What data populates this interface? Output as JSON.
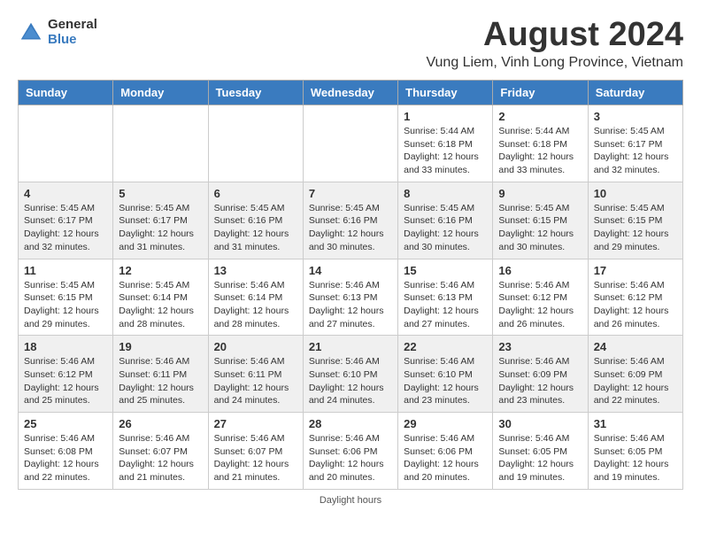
{
  "logo": {
    "general": "General",
    "blue": "Blue"
  },
  "title": {
    "month_year": "August 2024",
    "location": "Vung Liem, Vinh Long Province, Vietnam"
  },
  "headers": [
    "Sunday",
    "Monday",
    "Tuesday",
    "Wednesday",
    "Thursday",
    "Friday",
    "Saturday"
  ],
  "weeks": [
    [
      {
        "day": "",
        "info": ""
      },
      {
        "day": "",
        "info": ""
      },
      {
        "day": "",
        "info": ""
      },
      {
        "day": "",
        "info": ""
      },
      {
        "day": "1",
        "info": "Sunrise: 5:44 AM\nSunset: 6:18 PM\nDaylight: 12 hours\nand 33 minutes."
      },
      {
        "day": "2",
        "info": "Sunrise: 5:44 AM\nSunset: 6:18 PM\nDaylight: 12 hours\nand 33 minutes."
      },
      {
        "day": "3",
        "info": "Sunrise: 5:45 AM\nSunset: 6:17 PM\nDaylight: 12 hours\nand 32 minutes."
      }
    ],
    [
      {
        "day": "4",
        "info": "Sunrise: 5:45 AM\nSunset: 6:17 PM\nDaylight: 12 hours\nand 32 minutes."
      },
      {
        "day": "5",
        "info": "Sunrise: 5:45 AM\nSunset: 6:17 PM\nDaylight: 12 hours\nand 31 minutes."
      },
      {
        "day": "6",
        "info": "Sunrise: 5:45 AM\nSunset: 6:16 PM\nDaylight: 12 hours\nand 31 minutes."
      },
      {
        "day": "7",
        "info": "Sunrise: 5:45 AM\nSunset: 6:16 PM\nDaylight: 12 hours\nand 30 minutes."
      },
      {
        "day": "8",
        "info": "Sunrise: 5:45 AM\nSunset: 6:16 PM\nDaylight: 12 hours\nand 30 minutes."
      },
      {
        "day": "9",
        "info": "Sunrise: 5:45 AM\nSunset: 6:15 PM\nDaylight: 12 hours\nand 30 minutes."
      },
      {
        "day": "10",
        "info": "Sunrise: 5:45 AM\nSunset: 6:15 PM\nDaylight: 12 hours\nand 29 minutes."
      }
    ],
    [
      {
        "day": "11",
        "info": "Sunrise: 5:45 AM\nSunset: 6:15 PM\nDaylight: 12 hours\nand 29 minutes."
      },
      {
        "day": "12",
        "info": "Sunrise: 5:45 AM\nSunset: 6:14 PM\nDaylight: 12 hours\nand 28 minutes."
      },
      {
        "day": "13",
        "info": "Sunrise: 5:46 AM\nSunset: 6:14 PM\nDaylight: 12 hours\nand 28 minutes."
      },
      {
        "day": "14",
        "info": "Sunrise: 5:46 AM\nSunset: 6:13 PM\nDaylight: 12 hours\nand 27 minutes."
      },
      {
        "day": "15",
        "info": "Sunrise: 5:46 AM\nSunset: 6:13 PM\nDaylight: 12 hours\nand 27 minutes."
      },
      {
        "day": "16",
        "info": "Sunrise: 5:46 AM\nSunset: 6:12 PM\nDaylight: 12 hours\nand 26 minutes."
      },
      {
        "day": "17",
        "info": "Sunrise: 5:46 AM\nSunset: 6:12 PM\nDaylight: 12 hours\nand 26 minutes."
      }
    ],
    [
      {
        "day": "18",
        "info": "Sunrise: 5:46 AM\nSunset: 6:12 PM\nDaylight: 12 hours\nand 25 minutes."
      },
      {
        "day": "19",
        "info": "Sunrise: 5:46 AM\nSunset: 6:11 PM\nDaylight: 12 hours\nand 25 minutes."
      },
      {
        "day": "20",
        "info": "Sunrise: 5:46 AM\nSunset: 6:11 PM\nDaylight: 12 hours\nand 24 minutes."
      },
      {
        "day": "21",
        "info": "Sunrise: 5:46 AM\nSunset: 6:10 PM\nDaylight: 12 hours\nand 24 minutes."
      },
      {
        "day": "22",
        "info": "Sunrise: 5:46 AM\nSunset: 6:10 PM\nDaylight: 12 hours\nand 23 minutes."
      },
      {
        "day": "23",
        "info": "Sunrise: 5:46 AM\nSunset: 6:09 PM\nDaylight: 12 hours\nand 23 minutes."
      },
      {
        "day": "24",
        "info": "Sunrise: 5:46 AM\nSunset: 6:09 PM\nDaylight: 12 hours\nand 22 minutes."
      }
    ],
    [
      {
        "day": "25",
        "info": "Sunrise: 5:46 AM\nSunset: 6:08 PM\nDaylight: 12 hours\nand 22 minutes."
      },
      {
        "day": "26",
        "info": "Sunrise: 5:46 AM\nSunset: 6:07 PM\nDaylight: 12 hours\nand 21 minutes."
      },
      {
        "day": "27",
        "info": "Sunrise: 5:46 AM\nSunset: 6:07 PM\nDaylight: 12 hours\nand 21 minutes."
      },
      {
        "day": "28",
        "info": "Sunrise: 5:46 AM\nSunset: 6:06 PM\nDaylight: 12 hours\nand 20 minutes."
      },
      {
        "day": "29",
        "info": "Sunrise: 5:46 AM\nSunset: 6:06 PM\nDaylight: 12 hours\nand 20 minutes."
      },
      {
        "day": "30",
        "info": "Sunrise: 5:46 AM\nSunset: 6:05 PM\nDaylight: 12 hours\nand 19 minutes."
      },
      {
        "day": "31",
        "info": "Sunrise: 5:46 AM\nSunset: 6:05 PM\nDaylight: 12 hours\nand 19 minutes."
      }
    ]
  ],
  "footer": "Daylight hours"
}
